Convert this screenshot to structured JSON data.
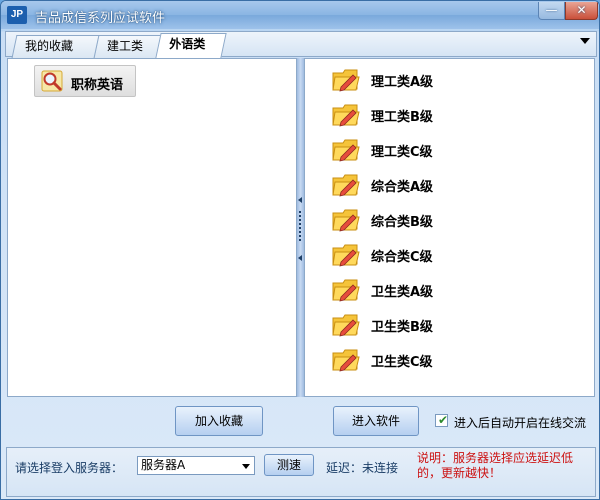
{
  "window": {
    "logo_text": "JP",
    "title": "吉品成信系列应试软件",
    "minimize_glyph": "—",
    "close_glyph": "✕"
  },
  "tabs": [
    {
      "label": "我的收藏",
      "active": false
    },
    {
      "label": "建工类",
      "active": false
    },
    {
      "label": "外语类",
      "active": true
    }
  ],
  "favorites": {
    "items": [
      {
        "label": "职称英语",
        "icon": "magnifier-icon"
      }
    ]
  },
  "subjects": {
    "icon": "folder-pencil-icon",
    "items": [
      {
        "label": "理工类A级"
      },
      {
        "label": "理工类B级"
      },
      {
        "label": "理工类C级"
      },
      {
        "label": "综合类A级"
      },
      {
        "label": "综合类B级"
      },
      {
        "label": "综合类C级"
      },
      {
        "label": "卫生类A级"
      },
      {
        "label": "卫生类B级"
      },
      {
        "label": "卫生类C级"
      }
    ]
  },
  "actions": {
    "add_favorite_label": "加入收藏",
    "enter_software_label": "进入软件",
    "auto_open_label": "进入后自动开启在线交流",
    "auto_open_checked": true
  },
  "server": {
    "prompt_label": "请选择登入服务器：",
    "selected": "服务器A",
    "speed_test_label": "测速",
    "latency_label": "延迟：未连接",
    "note": "说明：服务器选择应选延迟低的，更新越快！"
  },
  "colors": {
    "title_bar": "#8ab5e3",
    "note_red": "#cc1111",
    "folder_yellow": "#f5c43a"
  }
}
